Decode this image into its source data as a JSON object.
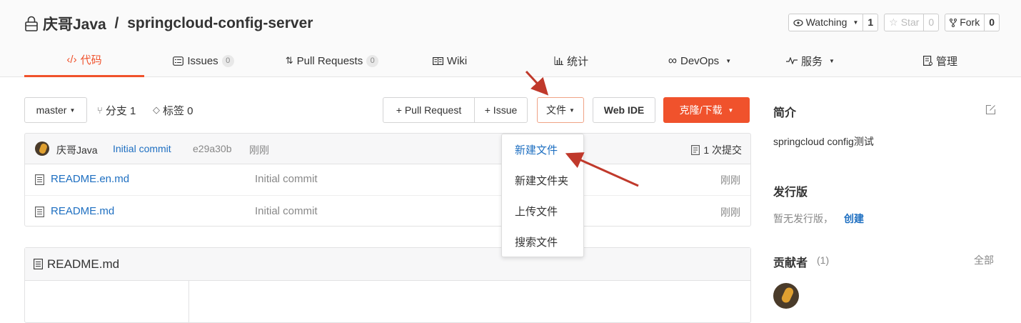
{
  "repo": {
    "owner": "庆哥Java",
    "separator": " / ",
    "name": "springcloud-config-server"
  },
  "header_buttons": {
    "watching": {
      "label": "Watching",
      "count": "1"
    },
    "star": {
      "label": "Star",
      "count": "0"
    },
    "fork": {
      "label": "Fork",
      "count": "0"
    }
  },
  "tabs": [
    {
      "label": "代码",
      "icon": "code-icon"
    },
    {
      "label": "Issues",
      "badge": "0",
      "icon": "issues-icon"
    },
    {
      "label": "Pull Requests",
      "badge": "0",
      "icon": "pull-request-icon"
    },
    {
      "label": "Wiki",
      "icon": "wiki-icon"
    },
    {
      "label": "统计",
      "icon": "stats-icon"
    },
    {
      "label": "DevOps",
      "icon": "devops-icon"
    },
    {
      "label": "服务",
      "icon": "service-icon"
    },
    {
      "label": "管理",
      "icon": "manage-icon"
    }
  ],
  "toolbar": {
    "branch": "master",
    "branches": "分支 1",
    "tags": "标签 0",
    "pull_request": "+ Pull Request",
    "issue": "+ Issue",
    "file": "文件",
    "web_ide": "Web IDE",
    "clone": "克隆/下载"
  },
  "commit": {
    "author": "庆哥Java",
    "message": "Initial commit",
    "hash": "e29a30b",
    "time": "刚刚",
    "count": "1 次提交"
  },
  "files": [
    {
      "name": "README.en.md",
      "message": "Initial commit",
      "time": "刚刚"
    },
    {
      "name": "README.md",
      "message": "Initial commit",
      "time": "刚刚"
    }
  ],
  "readme": {
    "title": "README.md"
  },
  "file_menu": {
    "items": [
      "新建文件",
      "新建文件夹",
      "上传文件",
      "搜索文件"
    ]
  },
  "sidebar": {
    "intro_title": "简介",
    "intro_text": "springcloud config测试",
    "release_title": "发行版",
    "release_text": "暂无发行版，",
    "release_link": "创建",
    "contrib_title": "贡献者",
    "contrib_count": "(1)",
    "contrib_all": "全部"
  },
  "colors": {
    "accent": "#f0522c",
    "link": "#1e6fc1",
    "arrow": "#c0392b"
  }
}
